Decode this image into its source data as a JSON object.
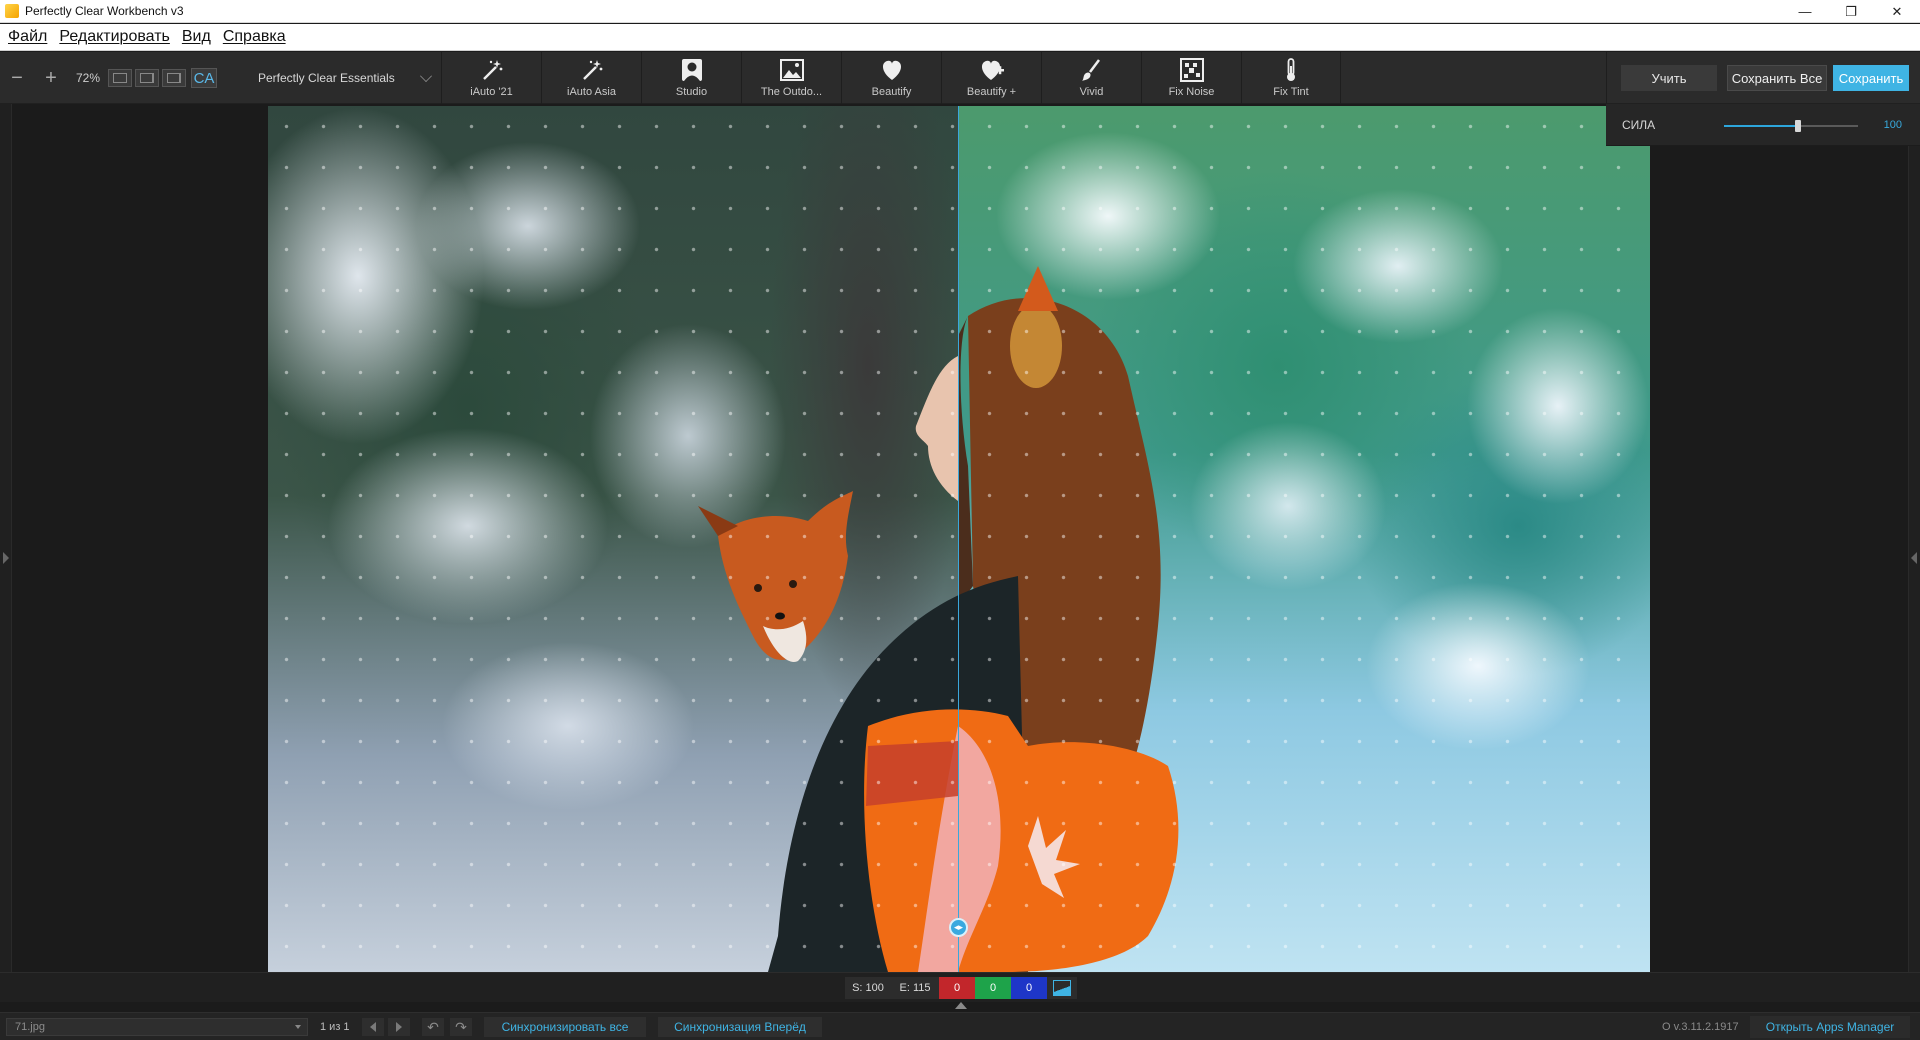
{
  "window": {
    "title": "Perfectly Clear Workbench v3",
    "controls": [
      "—",
      "❐",
      "✕"
    ]
  },
  "menu": {
    "items": [
      "Файл",
      "Редактировать",
      "Вид",
      "Справка"
    ]
  },
  "toolbar": {
    "zoom_out": "−",
    "zoom_in": "+",
    "zoom_level": "72%",
    "ca_label": "CA",
    "preset_name": "Perfectly Clear Essentials",
    "presets": [
      {
        "label": "iAuto '21",
        "icon": "magic-wand-icon"
      },
      {
        "label": "iAuto Asia",
        "icon": "magic-wand-icon"
      },
      {
        "label": "Studio",
        "icon": "portrait-icon"
      },
      {
        "label": "The Outdo...",
        "icon": "landscape-icon"
      },
      {
        "label": "Beautify",
        "icon": "heart-icon"
      },
      {
        "label": "Beautify +",
        "icon": "heart-plus-icon"
      },
      {
        "label": "Vivid",
        "icon": "brush-icon"
      },
      {
        "label": "Fix Noise",
        "icon": "noise-icon"
      },
      {
        "label": "Fix Tint",
        "icon": "thermometer-icon"
      }
    ],
    "learn_label": "Учить",
    "save_all_label": "Сохранить Все",
    "save_label": "Сохранить"
  },
  "strength": {
    "label": "СИЛА",
    "value": "100",
    "fill_fraction": 0.55
  },
  "info": {
    "s": "S: 100",
    "e": "E: 115",
    "r": "0",
    "g": "0",
    "b": "0"
  },
  "status": {
    "file_name": "71.jpg",
    "page_count": "1 из 1",
    "sync_all": "Синхронизировать все",
    "sync_forward": "Синхронизация Вперёд",
    "version": "О v.3.11.2.1917",
    "apps_manager": "Открыть Apps Manager"
  },
  "colors": {
    "accent": "#3fb4e4",
    "r": "#c2262b",
    "g": "#1ea34a",
    "b": "#1e36c8"
  }
}
